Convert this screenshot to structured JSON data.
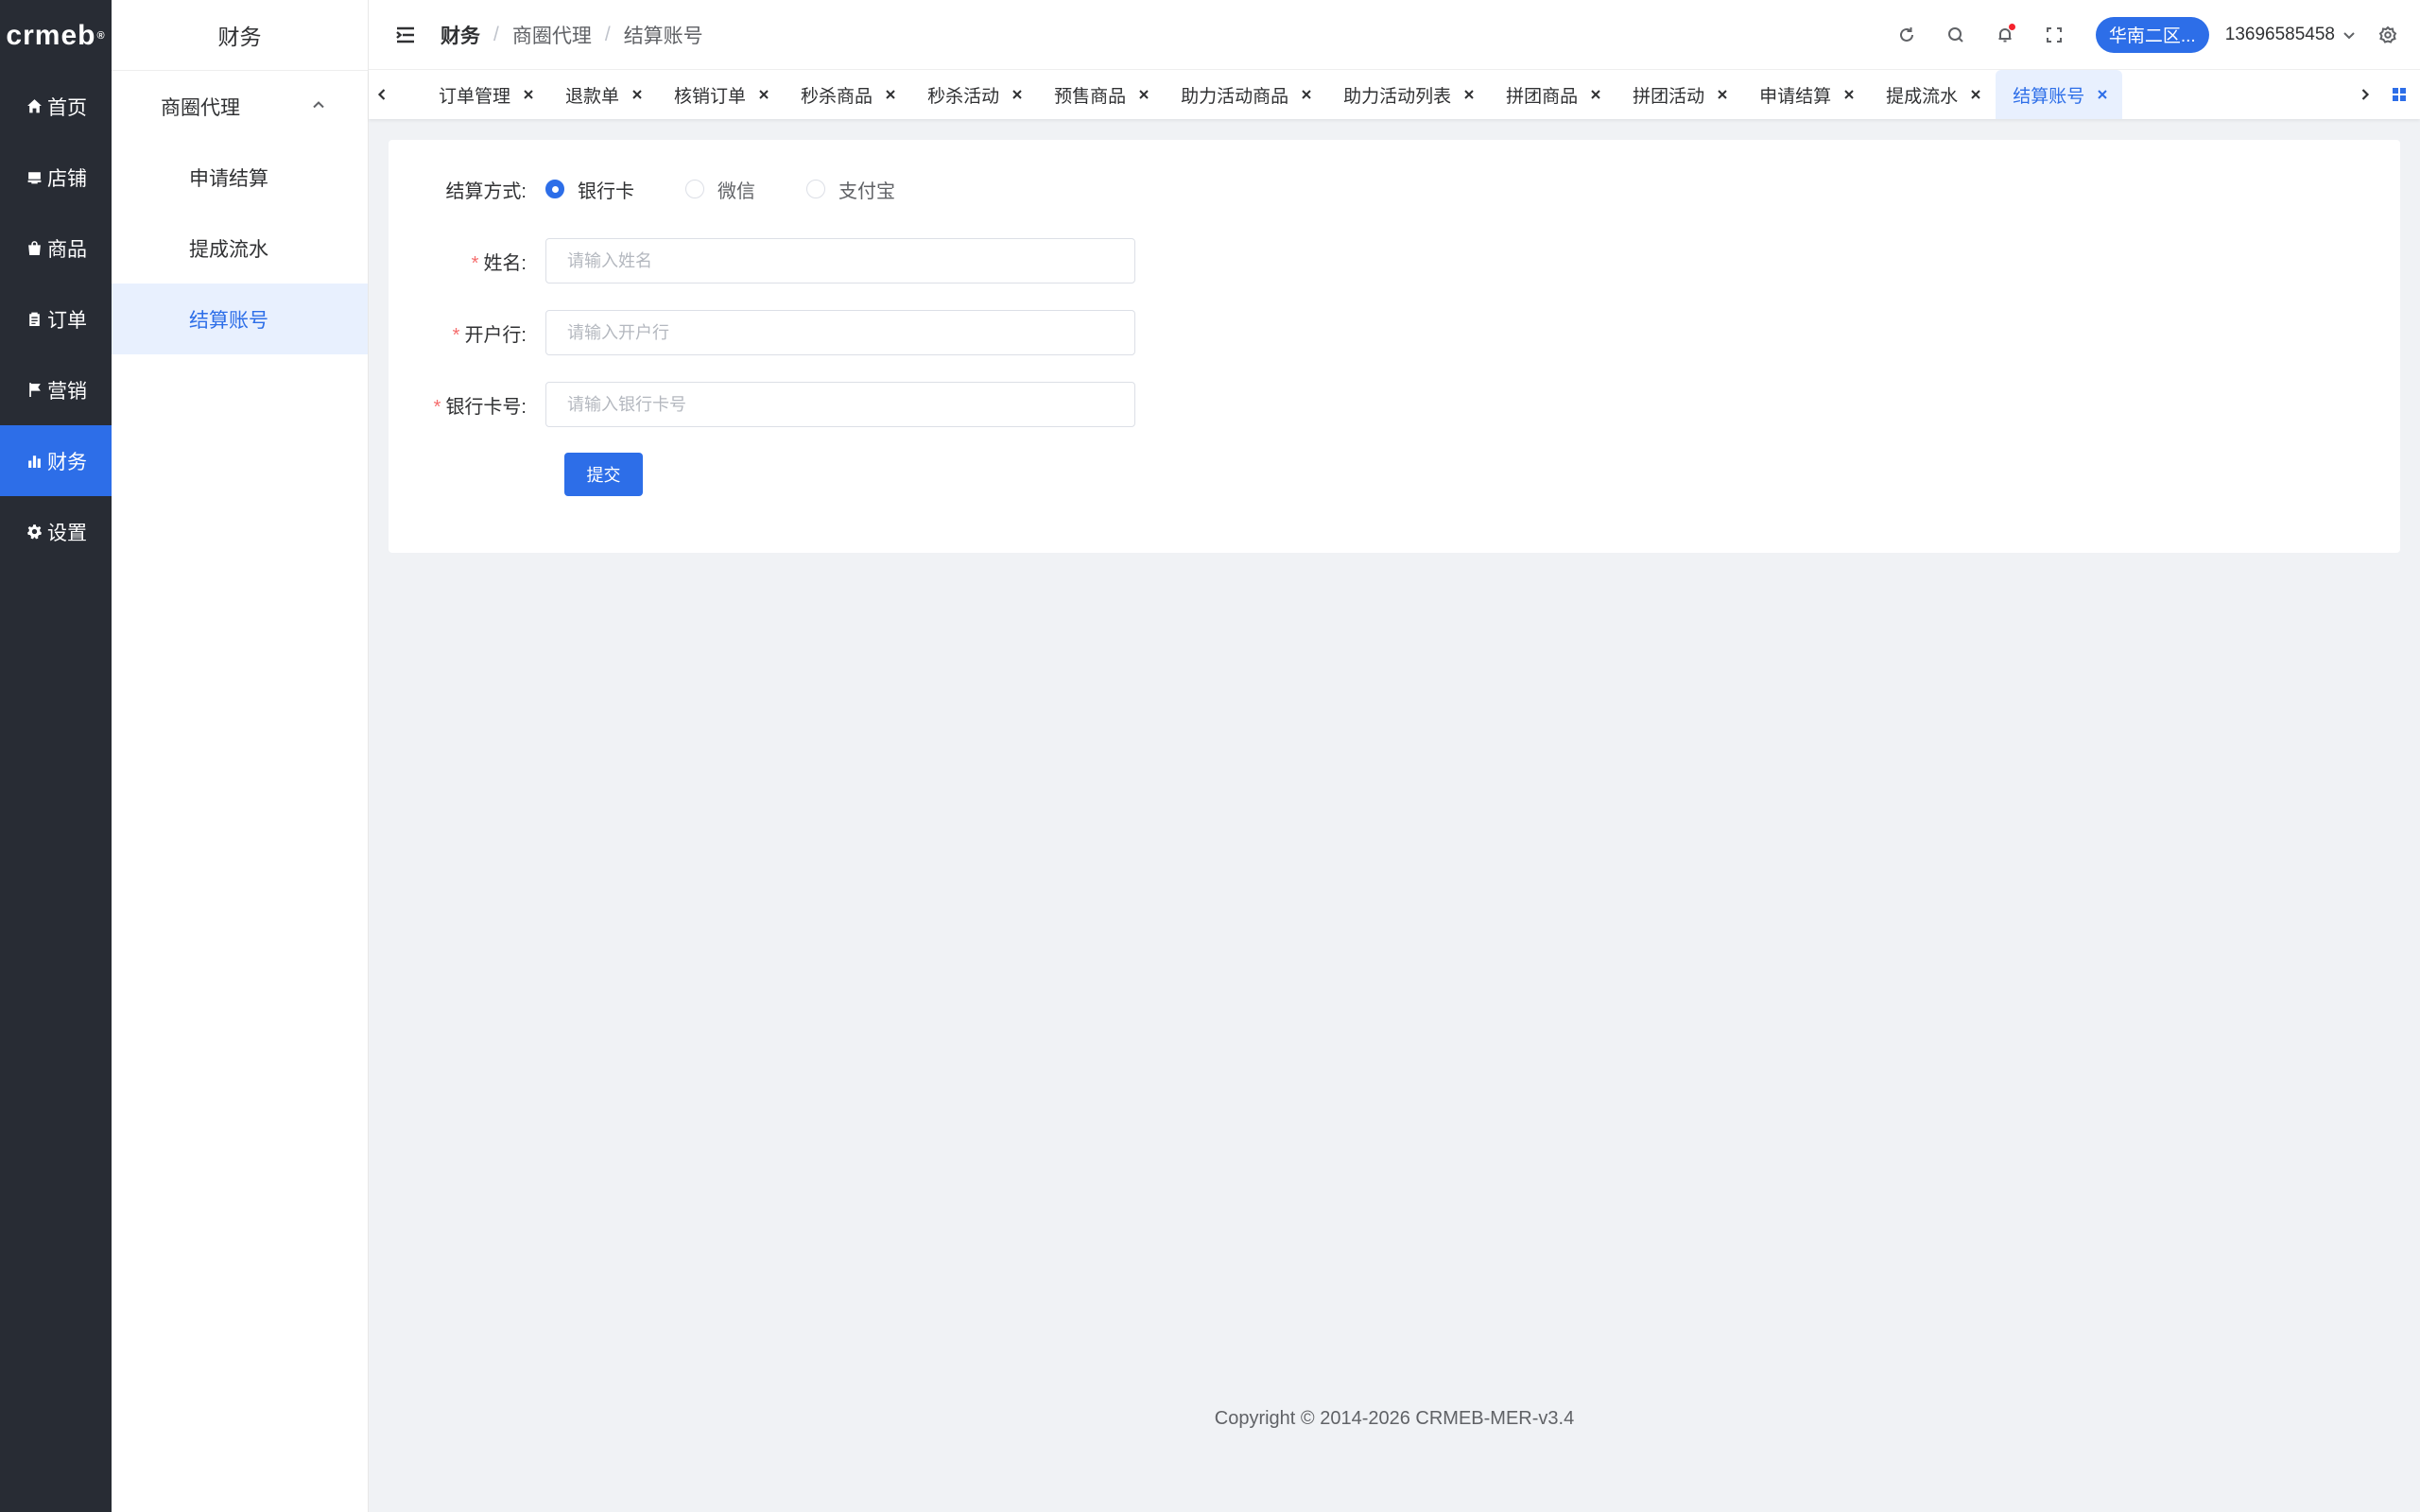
{
  "brand": {
    "logo_text": "crmeb",
    "logo_mark": "®"
  },
  "rail": {
    "items": [
      {
        "label": "首页",
        "icon": "home-icon"
      },
      {
        "label": "店铺",
        "icon": "shop-icon"
      },
      {
        "label": "商品",
        "icon": "bag-icon"
      },
      {
        "label": "订单",
        "icon": "clipboard-icon"
      },
      {
        "label": "营销",
        "icon": "flag-icon"
      },
      {
        "label": "财务",
        "icon": "bar-chart-icon",
        "active": true
      },
      {
        "label": "设置",
        "icon": "gear-icon"
      }
    ]
  },
  "subnav": {
    "title": "财务",
    "group": "商圈代理",
    "items": [
      "申请结算",
      "提成流水",
      "结算账号"
    ],
    "active_index": 2
  },
  "header": {
    "breadcrumbs": [
      "财务",
      "商圈代理",
      "结算账号"
    ],
    "separator": "/",
    "store_button": "华南二区...",
    "user_phone": "13696585458"
  },
  "tags": {
    "items": [
      "订单管理",
      "退款单",
      "核销订单",
      "秒杀商品",
      "秒杀活动",
      "预售商品",
      "助力活动商品",
      "助力活动列表",
      "拼团商品",
      "拼团活动",
      "申请结算",
      "提成流水",
      "结算账号"
    ],
    "active_index": 12
  },
  "form": {
    "method_label": "结算方式:",
    "methods": [
      "银行卡",
      "微信",
      "支付宝"
    ],
    "selected_method": 0,
    "required_mark": "*",
    "name_label": "姓名:",
    "name_placeholder": "请输入姓名",
    "bank_label": "开户行:",
    "bank_placeholder": "请输入开户行",
    "card_label": "银行卡号:",
    "card_placeholder": "请输入银行卡号",
    "submit_label": "提交"
  },
  "footer": {
    "copyright": "Copyright © 2014-2026 CRMEB-MER-v3.4"
  },
  "colors": {
    "primary": "#2d6ee8",
    "rail_bg": "#282c34",
    "page_bg": "#f0f2f5",
    "required": "#f56c6c"
  }
}
